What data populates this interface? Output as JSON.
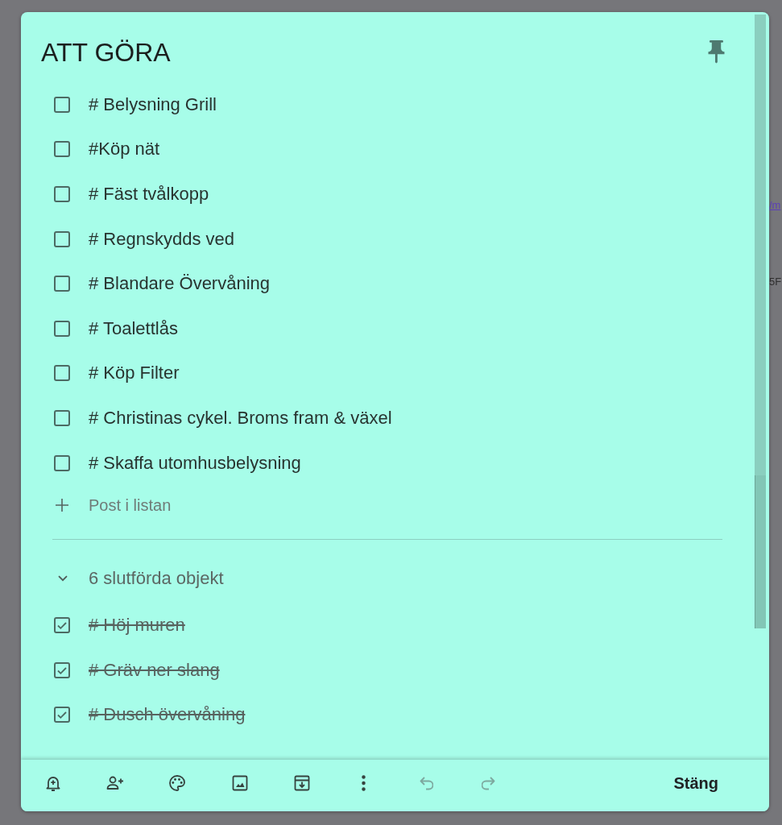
{
  "note": {
    "title": "ATT GÖRA",
    "pinned": true,
    "items": [
      {
        "text": "# Belysning Grill",
        "checked": false
      },
      {
        "text": "#Köp nät",
        "checked": false
      },
      {
        "text": "# Fäst tvålkopp",
        "checked": false
      },
      {
        "text": "# Regnskydds ved",
        "checked": false
      },
      {
        "text": "# Blandare Övervåning",
        "checked": false
      },
      {
        "text": "# Toalettlås",
        "checked": false
      },
      {
        "text": "# Köp Filter",
        "checked": false
      },
      {
        "text": "# Christinas cykel. Broms fram & växel",
        "checked": false
      },
      {
        "text": "# Skaffa utomhusbelysning",
        "checked": false
      }
    ],
    "add_item": {
      "placeholder": "Post i listan"
    },
    "completed": {
      "label": "6 slutförda objekt",
      "expanded": true,
      "items": [
        {
          "text": "# Höj muren",
          "checked": true
        },
        {
          "text": "# Gräv ner slang",
          "checked": true
        },
        {
          "text": "# Dusch övervåning",
          "checked": true
        }
      ]
    }
  },
  "toolbar": {
    "buttons": [
      {
        "kind": "reminder",
        "disabled": false
      },
      {
        "kind": "collaborator",
        "disabled": false
      },
      {
        "kind": "color",
        "disabled": false
      },
      {
        "kind": "image",
        "disabled": false
      },
      {
        "kind": "archive",
        "disabled": false
      },
      {
        "kind": "more",
        "disabled": false
      },
      {
        "kind": "undo",
        "disabled": true
      },
      {
        "kind": "redo",
        "disabled": true
      }
    ],
    "close": "Stäng"
  },
  "backdrop": {
    "fragments": [
      {
        "text": "/m",
        "kind": "link"
      },
      {
        "text": "5F",
        "kind": "text"
      }
    ]
  }
}
